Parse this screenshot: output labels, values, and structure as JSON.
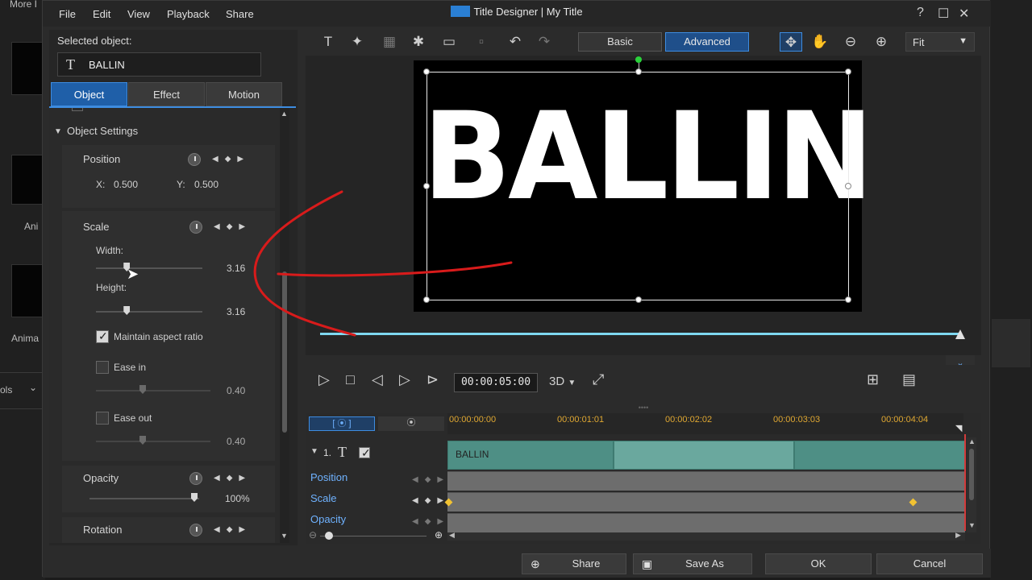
{
  "window": {
    "title": "Title Designer",
    "subtitle": "My Title",
    "menu": [
      "File",
      "Edit",
      "View",
      "Playback",
      "Share"
    ]
  },
  "background": {
    "left_labels": [
      "More I",
      "Ani",
      "Anima",
      "ols"
    ]
  },
  "left_panel": {
    "selected_label": "Selected object:",
    "selected_value": "BALLIN",
    "tabs": [
      {
        "label": "Object",
        "active": true
      },
      {
        "label": "Effect",
        "active": false
      },
      {
        "label": "Motion",
        "active": false
      }
    ],
    "section": "Object Settings",
    "position": {
      "label": "Position",
      "x_label": "X:",
      "x": "0.500",
      "y_label": "Y:",
      "y": "0.500"
    },
    "scale": {
      "label": "Scale",
      "width_label": "Width:",
      "width": "3.16",
      "height_label": "Height:",
      "height": "3.16",
      "width_fraction": 0.29,
      "height_fraction": 0.29
    },
    "maintain_aspect": {
      "label": "Maintain aspect ratio",
      "checked": true
    },
    "ease_in": {
      "label": "Ease in",
      "checked": false,
      "value": "0.40"
    },
    "ease_out": {
      "label": "Ease out",
      "checked": false,
      "value": "0.40"
    },
    "opacity": {
      "label": "Opacity",
      "value": "100%"
    },
    "rotation": {
      "label": "Rotation"
    }
  },
  "toolbar": {
    "mode_basic": "Basic",
    "mode_advanced": "Advanced",
    "zoom": "Fit"
  },
  "preview": {
    "text": "BALLIN",
    "progress": 1.0
  },
  "controls": {
    "timecode": "00:00:05:00",
    "mode_3d": "3D"
  },
  "timeline": {
    "ruler": [
      "00:00:00:00",
      "00:00:01:01",
      "00:00:02:02",
      "00:00:03:03",
      "00:00:04:04"
    ],
    "track_index": "1.",
    "clip_label": "BALLIN",
    "rows": [
      "Position",
      "Scale",
      "Opacity"
    ]
  },
  "buttons": {
    "share": "Share",
    "save_as": "Save As",
    "ok": "OK",
    "cancel": "Cancel"
  },
  "colors": {
    "accent": "#3d8ce0",
    "keyframe": "#f1c232",
    "progress": "#7fd8f0"
  }
}
